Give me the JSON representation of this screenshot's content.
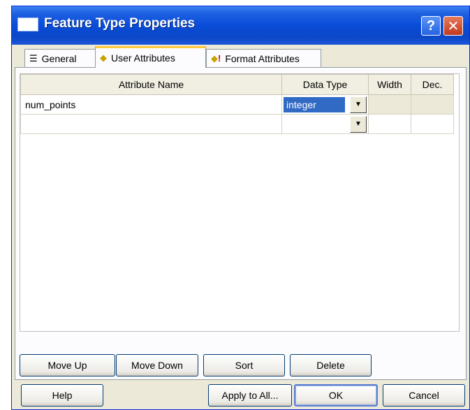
{
  "window": {
    "title": "Feature Type Properties"
  },
  "tabs": [
    {
      "label": "General",
      "icon": "list-icon"
    },
    {
      "label": "User Attributes",
      "icon": "diamond-icon"
    },
    {
      "label": "Format Attributes",
      "icon": "diamond-exclamation-icon"
    }
  ],
  "grid": {
    "columns": [
      "Attribute Name",
      "Data Type",
      "Width",
      "Dec."
    ],
    "rows": [
      {
        "name": "num_points",
        "type": "integer",
        "width": "",
        "dec": ""
      },
      {
        "name": "",
        "type": "",
        "width": "",
        "dec": ""
      }
    ]
  },
  "panel_buttons": {
    "move_up": "Move Up",
    "move_down": "Move Down",
    "sort": "Sort",
    "delete": "Delete"
  },
  "dialog_buttons": {
    "help": "Help",
    "apply_all": "Apply to All...",
    "ok": "OK",
    "cancel": "Cancel"
  },
  "colors": {
    "title_bar": "#0A4CD8",
    "selection": "#316AC5",
    "dialog_bg": "#ECE9D8",
    "close_button": "#C2391C"
  }
}
